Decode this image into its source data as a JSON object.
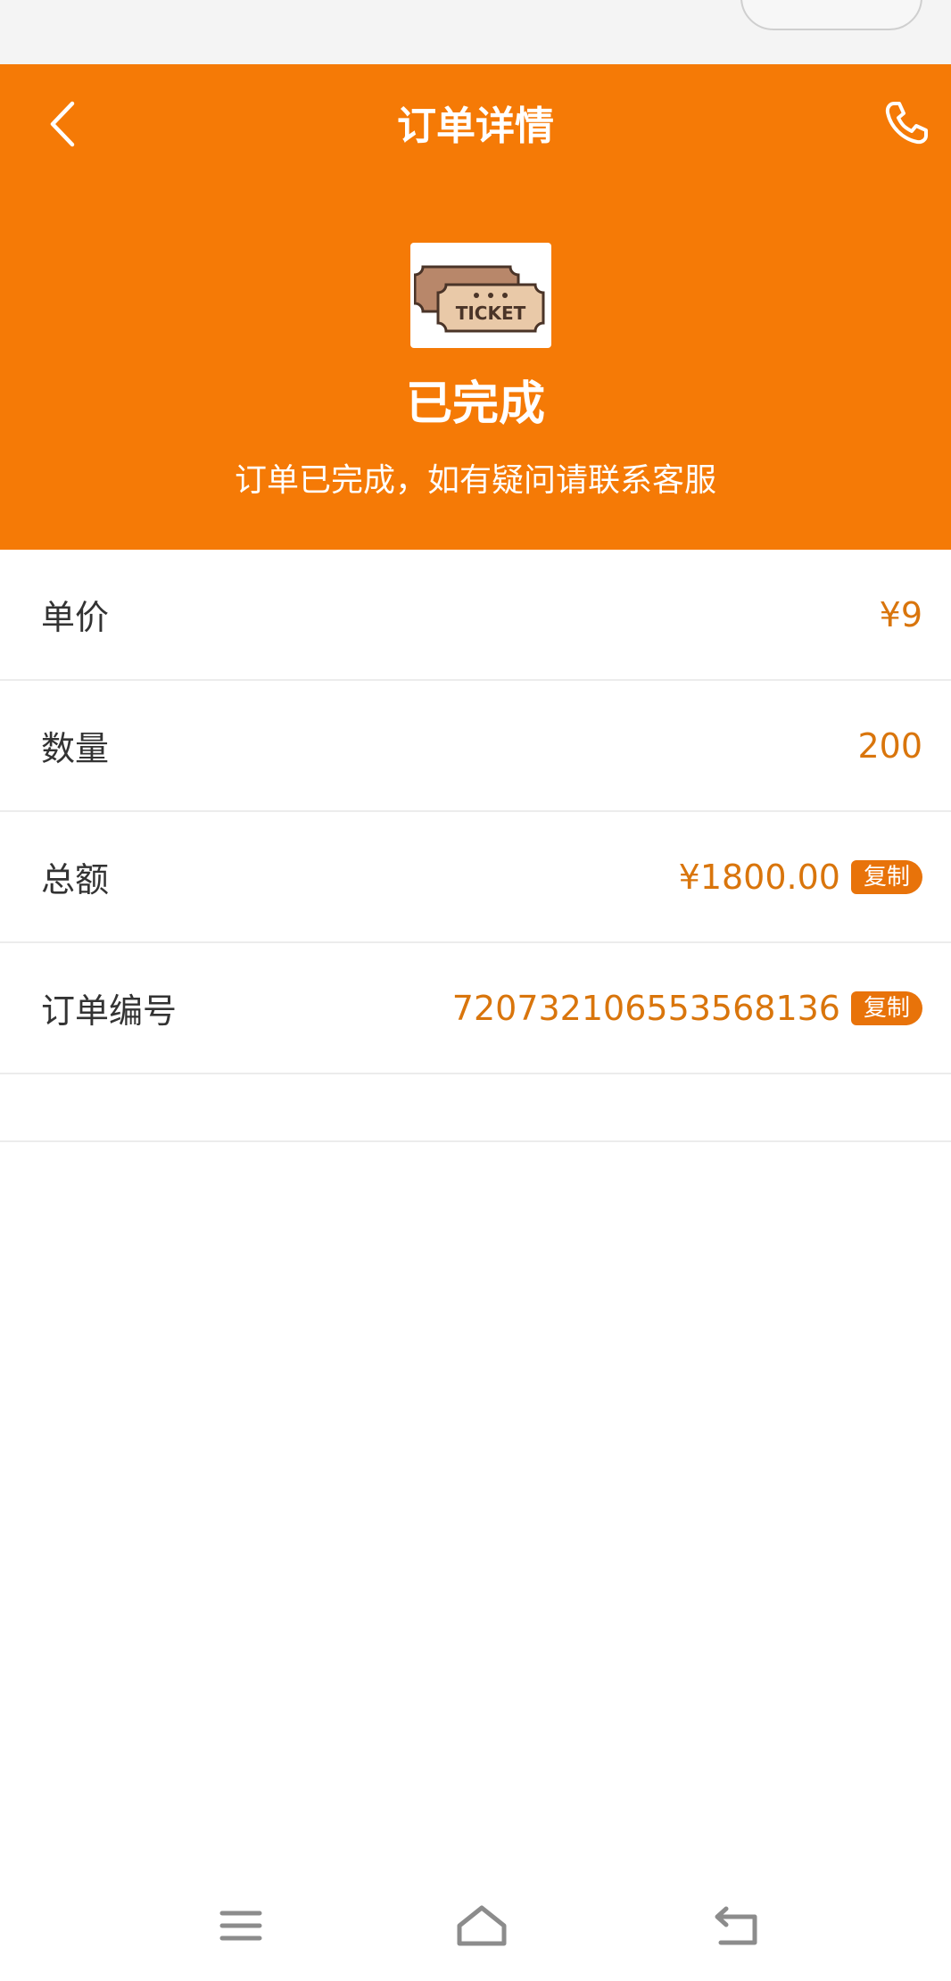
{
  "header": {
    "title": "订单详情",
    "back_icon": "chevron-left-icon",
    "phone_icon": "phone-icon",
    "bg_color": "#f57a06"
  },
  "order": {
    "image_label": "TICKET",
    "status": "已完成",
    "status_message": "订单已完成，如有疑问请联系客服"
  },
  "details": [
    {
      "label": "单价",
      "value": "¥9"
    },
    {
      "label": "数量",
      "value": "200"
    },
    {
      "label": "总额",
      "value": "¥1800.00",
      "copy": "复制"
    },
    {
      "label": "订单编号",
      "value": "720732106553568136",
      "copy": "复制"
    }
  ],
  "navbar": {
    "menu_icon": "menu-icon",
    "home_icon": "home-icon",
    "back_icon": "back-icon"
  },
  "colors": {
    "accent": "#f57a06",
    "value_text": "#d9750c",
    "copy_button": "#e8730a"
  }
}
